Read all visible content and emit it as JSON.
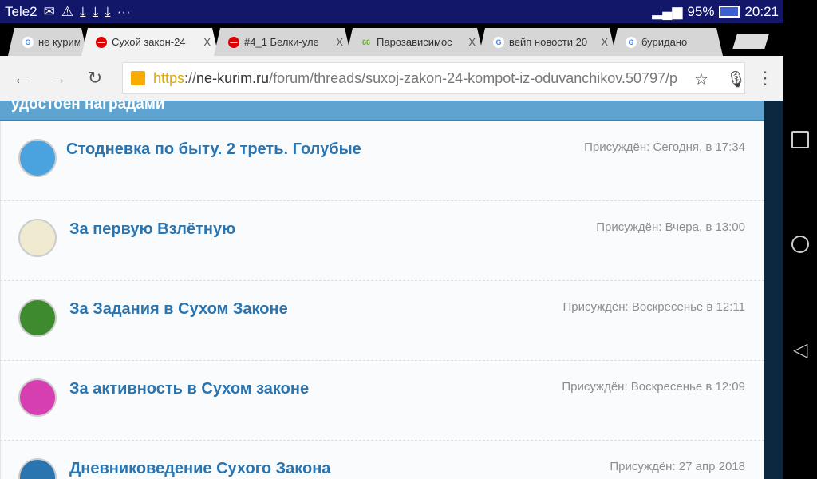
{
  "status": {
    "carrier": "Tele2",
    "battery": "95%",
    "time": "20:21",
    "icons": [
      "mail-icon",
      "warning-icon",
      "download-icon",
      "download-icon",
      "download-icon",
      "more-icon"
    ]
  },
  "tabs": [
    {
      "title": "не курим",
      "favicon": "google",
      "active": false
    },
    {
      "title": "Сухой закон-24",
      "favicon": "stop",
      "active": true
    },
    {
      "title": "#4_1 Белки-уле",
      "favicon": "stop",
      "active": false
    },
    {
      "title": "Парозависимос",
      "favicon": "66",
      "active": false
    },
    {
      "title": "вейп новости 20",
      "favicon": "google",
      "active": false
    },
    {
      "title": "буридано",
      "favicon": "google",
      "active": false
    }
  ],
  "toolbar": {
    "url_scheme": "https",
    "url_sep": "://",
    "url_host": "ne-kurim.ru",
    "url_path": "/forum/threads/suxoj-zakon-24-kompot-iz-oduvanchikov.50797/p"
  },
  "section": {
    "header": "удостоен наградами"
  },
  "awards": [
    {
      "title": "Стодневка по быту. 2 треть. Голубые",
      "date": "Присуждён: Сегодня, в 17:34",
      "color": "#4aa3df"
    },
    {
      "title": "За первую Взлётную",
      "date": "Присуждён: Вчера, в 13:00",
      "color": "#f0ead0"
    },
    {
      "title": "За Задания в Сухом Законе",
      "date": "Присуждён: Воскресенье в 12:11",
      "color": "#3e8a2e"
    },
    {
      "title": "За активность в Сухом законе",
      "date": "Присуждён: Воскресенье в 12:09",
      "color": "#d63fb0"
    },
    {
      "title": "Дневниковедение Сухого Закона",
      "date": "Присуждён: 27 апр 2018",
      "color": "#2a74b0"
    }
  ]
}
